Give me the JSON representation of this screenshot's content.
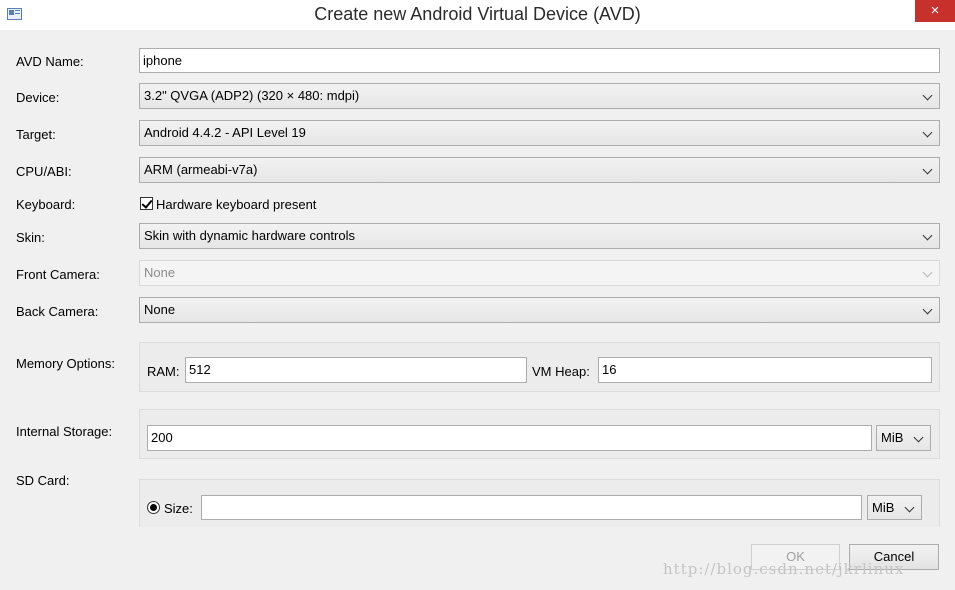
{
  "window": {
    "title": "Create new Android Virtual Device (AVD)",
    "close_glyph": "×"
  },
  "form": {
    "avd_name": {
      "label": "AVD Name:",
      "value": "iphone"
    },
    "device": {
      "label": "Device:",
      "value": "3.2\" QVGA (ADP2) (320 × 480: mdpi)"
    },
    "target": {
      "label": "Target:",
      "value": "Android 4.4.2 - API Level 19"
    },
    "cpu_abi": {
      "label": "CPU/ABI:",
      "value": "ARM (armeabi-v7a)"
    },
    "keyboard": {
      "label": "Keyboard:",
      "checkbox_label": "Hardware keyboard present",
      "checked": true
    },
    "skin": {
      "label": "Skin:",
      "value": "Skin with dynamic hardware controls"
    },
    "front_camera": {
      "label": "Front Camera:",
      "value": "None"
    },
    "back_camera": {
      "label": "Back Camera:",
      "value": "None"
    },
    "memory": {
      "label": "Memory Options:",
      "ram_label": "RAM:",
      "ram_value": "512",
      "vm_heap_label": "VM Heap:",
      "vm_heap_value": "16"
    },
    "internal_storage": {
      "label": "Internal Storage:",
      "value": "200",
      "unit": "MiB"
    },
    "sd_card": {
      "label": "SD Card:",
      "size_label": "Size:",
      "size_value": "",
      "unit": "MiB",
      "size_selected": true
    }
  },
  "buttons": {
    "ok": "OK",
    "cancel": "Cancel"
  },
  "watermark": "http://blog.csdn.net/jkrlinux"
}
